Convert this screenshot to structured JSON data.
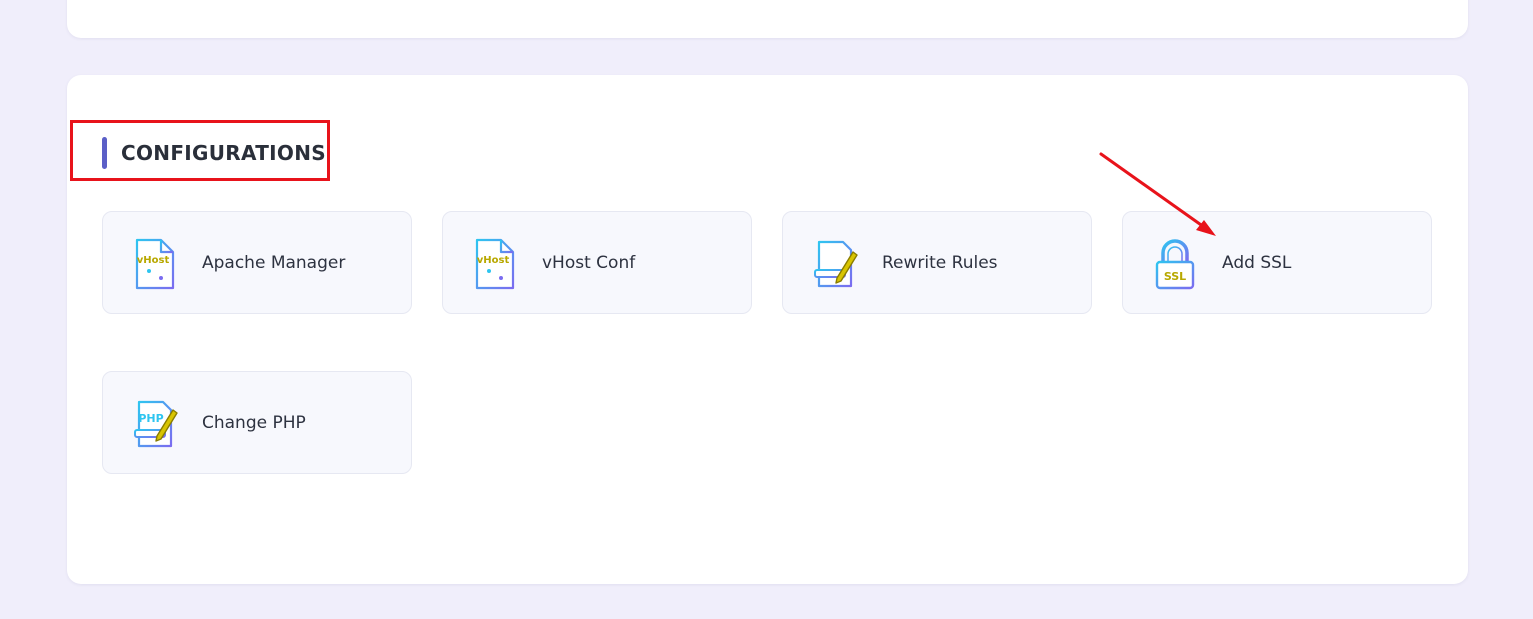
{
  "section": {
    "title": "CONFIGURATIONS"
  },
  "tiles": [
    {
      "label": "Apache Manager",
      "icon": "vhost-file-icon"
    },
    {
      "label": "vHost Conf",
      "icon": "vhost-file-icon"
    },
    {
      "label": "Rewrite Rules",
      "icon": "document-edit-icon"
    },
    {
      "label": "Add SSL",
      "icon": "ssl-lock-icon"
    },
    {
      "label": "Change PHP",
      "icon": "php-file-icon"
    }
  ],
  "icon_text": {
    "vhost": "vHost",
    "ssl": "SSL",
    "php": "PHP"
  },
  "colors": {
    "accent": "#5b5fc7",
    "annotation_red": "#e8131b",
    "icon_gradient_start": "#2ec5f0",
    "icon_gradient_end": "#7b6cf0",
    "icon_text": "#b8a800"
  }
}
